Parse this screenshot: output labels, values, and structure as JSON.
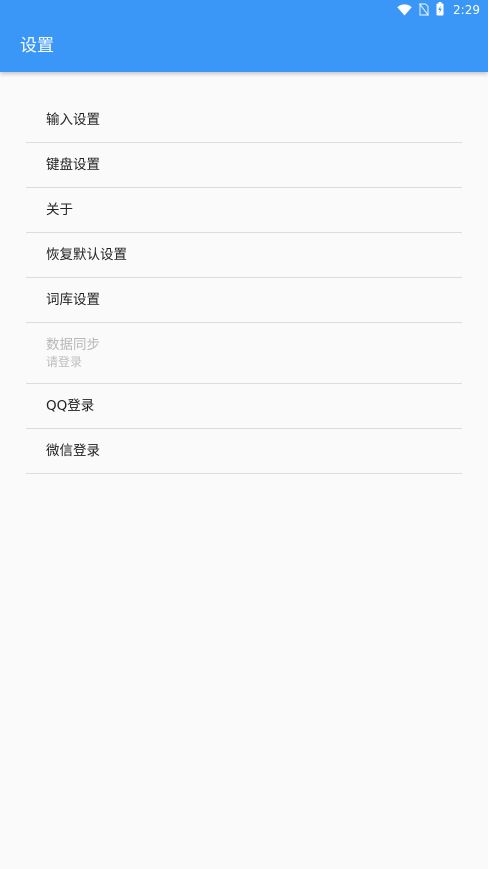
{
  "status_bar": {
    "time": "2:29",
    "icons": [
      "wifi-icon",
      "no-sim-icon",
      "battery-charging-icon"
    ]
  },
  "app_bar": {
    "title": "设置",
    "background": "#3a97f8"
  },
  "settings": {
    "items": [
      {
        "label": "输入设置"
      },
      {
        "label": "键盘设置"
      },
      {
        "label": "关于"
      },
      {
        "label": "恢复默认设置"
      },
      {
        "label": "词库设置"
      },
      {
        "label": "数据同步",
        "subtitle": "请登录",
        "enabled": false
      },
      {
        "label": "QQ登录"
      },
      {
        "label": "微信登录"
      }
    ]
  }
}
